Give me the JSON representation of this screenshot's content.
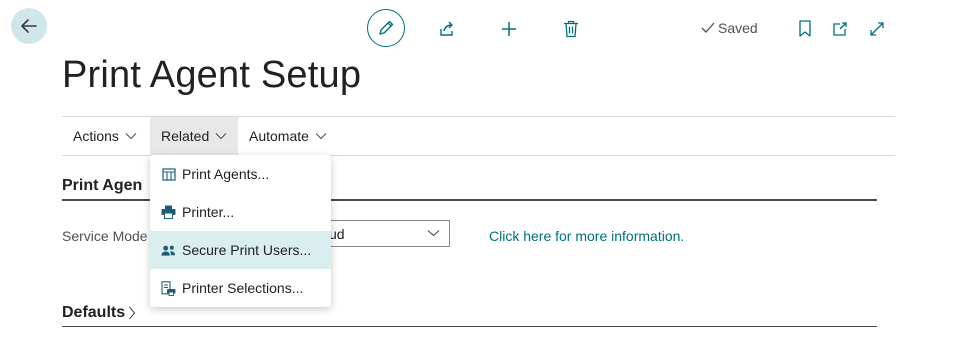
{
  "header": {
    "saved_label": "Saved"
  },
  "page": {
    "title": "Print Agent Setup"
  },
  "action_bar": {
    "actions_label": "Actions",
    "related_label": "Related",
    "automate_label": "Automate"
  },
  "related_menu": {
    "items": [
      {
        "label": "Print Agents...",
        "icon": "table-icon"
      },
      {
        "label": "Printer...",
        "icon": "printer-icon"
      },
      {
        "label": "Secure Print Users...",
        "icon": "users-icon"
      },
      {
        "label": "Printer Selections...",
        "icon": "printer-selections-icon"
      }
    ],
    "highlighted_index": 2
  },
  "sections": {
    "print_agent_title_visible": "Print Agen",
    "defaults_title": "Defaults"
  },
  "fields": {
    "service_mode_label": "Service Mode",
    "service_mode_value_visible": "ud",
    "info_link": "Click here for more information."
  },
  "colors": {
    "accent": "#00707a",
    "back_button_bg": "#cfe7ea",
    "menu_highlight": "#daeef0"
  }
}
